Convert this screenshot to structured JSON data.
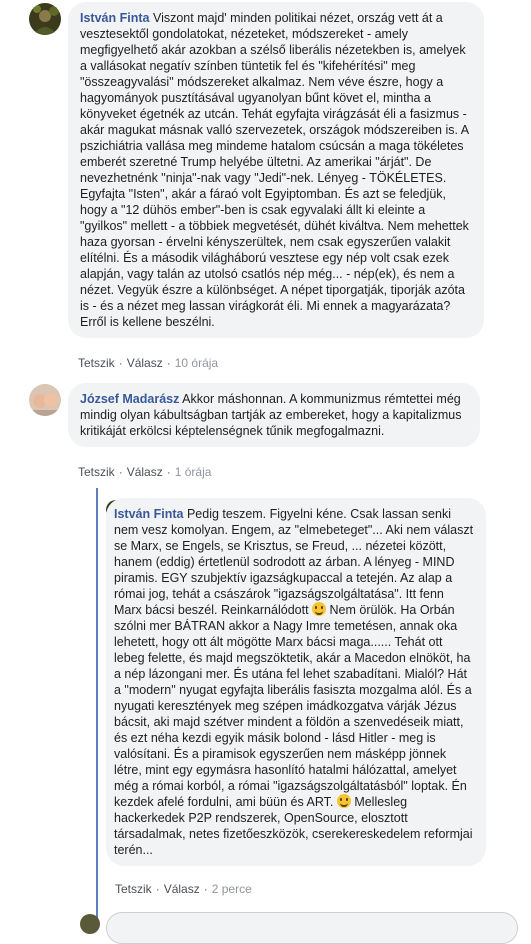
{
  "comments": [
    {
      "author": "István Finta",
      "text": "Viszont majd' minden politikai nézet, ország vett át a vesztesektől gondolatokat, nézeteket, módszereket - amely megfigyelhető akár azokban a szélső liberális nézetekben is, amelyek a vallásokat negatív színben tüntetik fel és \"kifehérítési\" meg \"összeagyvalási\" módszereket alkalmaz. Nem véve észre, hogy a hagyományok pusztításával ugyanolyan bűnt követ el, mintha a könyveket égetnék az utcán. Tehát egyfajta virágzását éli a fasizmus - akár magukat másnak valló szervezetek, országok módszereiben is. A pszichiátria vallása meg mindeme hatalom csúcsán a maga tökéletes emberét szeretné Trump helyébe ültetni. Az amerikai \"árját\". De nevezhetnénk \"ninja\"-nak vagy \"Jedi\"-nek. Lényeg - TÖKÉLETES. Egyfajta \"Isten\", akár a fáraó volt Egyiptomban. És azt se feledjük, hogy a \"12 dühös ember\"-ben is csak egyvalaki állt ki eleinte a \"gyilkos\" mellett - a többiek megvetését, dühét kiváltva. Nem mehettek haza gyorsan - érvelni kényszerültek, nem csak egyszerűen valakit elítélni. És a második világháború vesztese egy nép volt csak ezek alapján, vagy talán az utolsó csatlós nép még... - nép(ek), és nem a nézet. Vegyük észre a különbséget. A népet tiporgatják, tiporják azóta is - és a nézet meg lassan virágkorát éli. Mi ennek a magyarázata? Erről is kellene beszélni.",
      "like": "Tetszik",
      "reply": "Válasz",
      "time": "10 órája"
    },
    {
      "author": "József Madarász",
      "text": "Akkor máshonnan. A kommunizmus rémtettei még mindig olyan kábultságban tartják az embereket, hogy a kapitalizmus kritikáját erkölcsi képtelenségnek tűnik megfogalmazni.",
      "like": "Tetszik",
      "reply": "Válasz",
      "time": "1 órája"
    },
    {
      "author": "István Finta",
      "text_a": "Pedig teszem. Figyelni kéne. Csak lassan senki nem vesz komolyan. Engem, az \"elmebeteget\"... Aki nem választ se Marx, se Engels, se Krisztus, se Freud, ... nézetei között, hanem (eddig) értetlenül sodrodott az árban. A lényeg - MIND piramis. EGY szubjektív igazságkupaccal a tetején. Az alap a római jog, tehát a császárok \"igazságszolgáltatása\". Itt fenn Marx bácsi beszél. Reinkarnálódott",
      "text_b": "Nem örülök. Ha Orbán szólni mer BÁTRAN akkor a Nagy Imre temetésen, annak oka lehetett, hogy ott ált mögötte Marx bácsi maga...... Tehát ott lebeg felette, és majd megszöktetik, akár a Macedon elnököt, ha a nép lázongani mer. És utána fel lehet szabadítani. Mialól? Hát a \"modern\" nyugat egyfajta liberális fasiszta mozgalma alól. És a nyugati keresztények meg szépen imádkozgatva várják Jézus bácsit, aki majd szétver mindent a földön a szenvedéseik miatt, és ezt néha kezdi egyik másik bolond - lásd Hitler - meg is valósítani. És a piramisok egyszerűen nem másképp jönnek létre, mint egy egymásra hasonlító hatalmi hálózattal, amelyet még a római korból, a római \"igazságszolgáltatásból\" loptak. Én kezdek afelé fordulni, ami büün és ART.",
      "text_c": "Mellesleg hackerkedek P2P rendszerek, OpenSource, elosztott társadalmak, netes fizetőeszközök, cserekereskedelem reformjai terén...",
      "like": "Tetszik",
      "reply": "Válasz",
      "time": "2 perce"
    }
  ],
  "icons": [
    "smile-emoji",
    "avatar-photo"
  ]
}
